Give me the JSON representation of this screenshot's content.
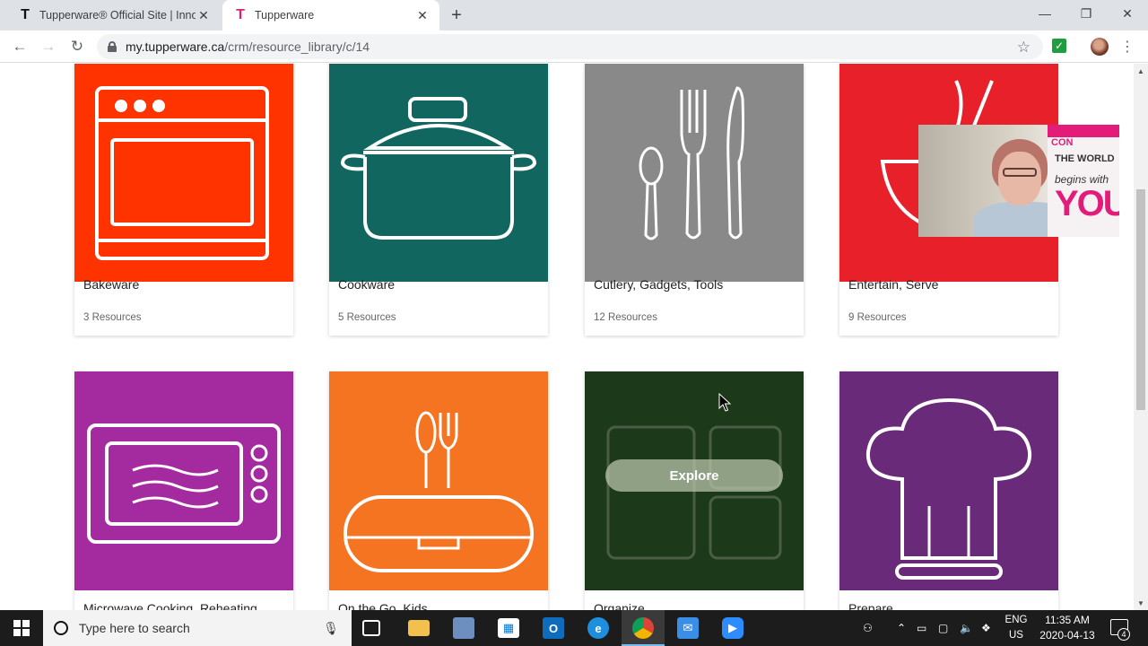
{
  "browser": {
    "tabs": [
      {
        "label": "Tupperware® Official Site | Innov",
        "favicon": "T",
        "active": false
      },
      {
        "label": "Tupperware",
        "favicon": "T",
        "active": true
      }
    ],
    "new_tab": "+",
    "url_domain": "my.tupperware.ca",
    "url_path": "/crm/resource_library/c/14"
  },
  "categories_row1": [
    {
      "name": "Bakeware",
      "count": "3 Resources",
      "bg": "#ff3300",
      "icon": "oven-icon"
    },
    {
      "name": "Cookware",
      "count": "5 Resources",
      "bg": "#126660",
      "icon": "pot-icon"
    },
    {
      "name": "Cutlery, Gadgets, Tools",
      "count": "12 Resources",
      "bg": "#898989",
      "icon": "cutlery-icon"
    },
    {
      "name": "Entertain, Serve",
      "count": "9 Resources",
      "bg": "#e8202a",
      "icon": "bowl-icon"
    }
  ],
  "categories_row2": [
    {
      "name": "Microwave Cooking, Reheating",
      "bg": "#a42a9f",
      "icon": "microwave-icon"
    },
    {
      "name": "On the Go, Kids",
      "bg": "#f47421",
      "icon": "lunchbox-icon"
    },
    {
      "name": "Organize",
      "bg": "#1c3a1a",
      "icon": "containers-icon",
      "hover_label": "Explore"
    },
    {
      "name": "Prepare",
      "bg": "#6a2a7a",
      "icon": "chef-hat-icon"
    }
  ],
  "webcam": {
    "poster_line1": "CON",
    "poster_line2": "THE WORLD",
    "poster_line3": "begins with",
    "poster_line4": "YOU"
  },
  "taskbar": {
    "search_placeholder": "Type here to search",
    "lang_line1": "ENG",
    "lang_line2": "US",
    "time": "11:35 AM",
    "date": "2020-04-13",
    "notifications": "4"
  }
}
